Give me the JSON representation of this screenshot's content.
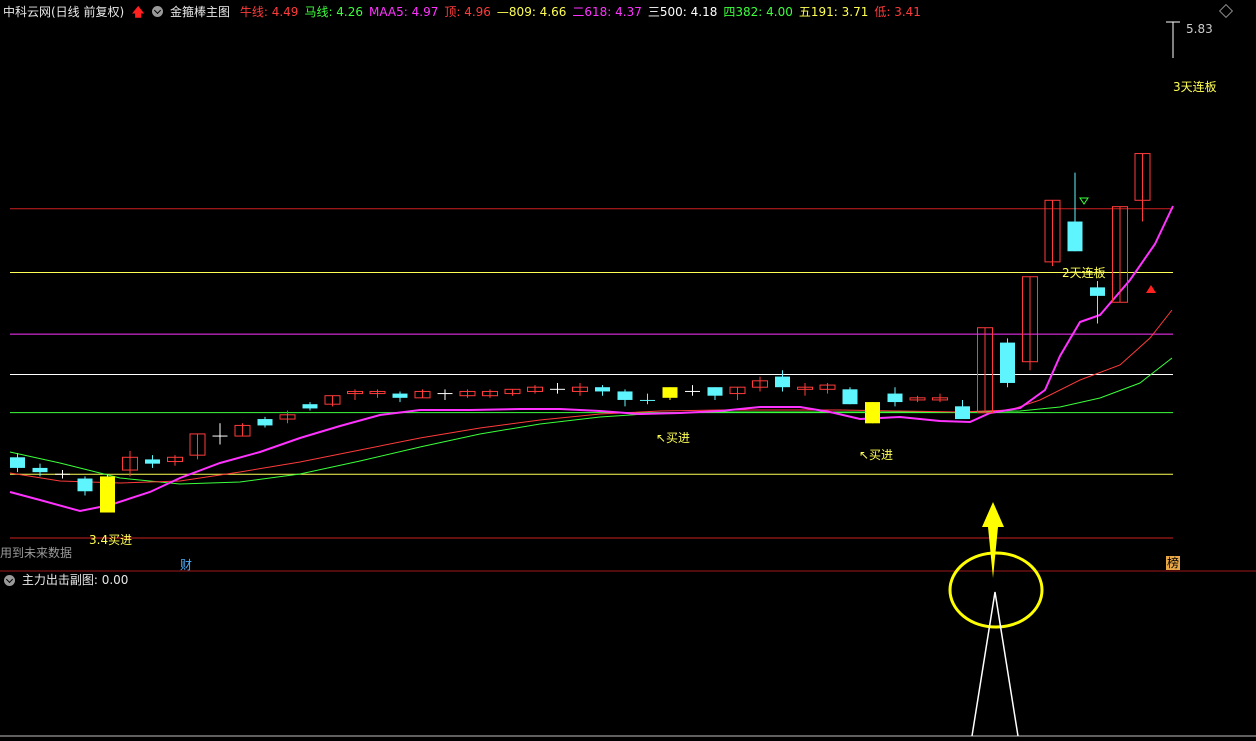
{
  "header": {
    "app_name": "中科云网(日线 前复权)",
    "indicator_name": "金箍棒主图",
    "items": [
      {
        "label": "牛线: ",
        "value": "4.49",
        "color": "#ff3b3b"
      },
      {
        "label": "马线: ",
        "value": "4.26",
        "color": "#3bff3b"
      },
      {
        "label": "MAA5: ",
        "value": "4.97",
        "color": "#ff33ff"
      },
      {
        "label": "顶: ",
        "value": "4.96",
        "color": "#ff3b3b"
      },
      {
        "label": "—809: ",
        "value": "4.66",
        "color": "#ffff55"
      },
      {
        "label": "二618: ",
        "value": "4.37",
        "color": "#ff33ff"
      },
      {
        "label": "三500: ",
        "value": "4.18",
        "color": "#ffffff"
      },
      {
        "label": "四382: ",
        "value": "4.00",
        "color": "#3bff3b"
      },
      {
        "label": "五191: ",
        "value": "3.71",
        "color": "#ffff55"
      },
      {
        "label": "低: ",
        "value": "3.41",
        "color": "#ff3b3b"
      }
    ]
  },
  "chart_annotations": {
    "high_price": "5.83",
    "limit_up_3": "3天连板",
    "limit_up_2": "2天连板",
    "buy_1": "3.4买进",
    "buy_2": "↖买进",
    "buy_3": "↖买进",
    "future_data_note": "用到未来数据",
    "finance_marker": "财",
    "rank_marker": "榜"
  },
  "sub_chart": {
    "title": "主力出击副图",
    "value_text": ": 0.00"
  },
  "colors": {
    "up": "#ff3b3b",
    "down": "#5ff5ff",
    "buy_candle": "#ffff00",
    "maa5": "#ff33ff",
    "niu": "#ff3b3b",
    "ma": "#3bff3b"
  },
  "chart_data": {
    "type": "candlestick",
    "levels": {
      "顶": 4.96,
      "—809": 4.66,
      "二618": 4.37,
      "三500": 4.18,
      "四382": 4.0,
      "五191": 3.71,
      "低": 3.41
    },
    "high_label": 5.83,
    "candles": [
      [
        3.79,
        3.74,
        3.81,
        3.72,
        "d"
      ],
      [
        3.74,
        3.72,
        3.76,
        3.7,
        "d"
      ],
      [
        3.71,
        3.71,
        3.73,
        3.69,
        "c"
      ],
      [
        3.69,
        3.63,
        3.7,
        3.61,
        "d"
      ],
      [
        3.53,
        3.7,
        3.71,
        3.53,
        "y"
      ],
      [
        3.73,
        3.79,
        3.82,
        3.7,
        "u"
      ],
      [
        3.78,
        3.76,
        3.8,
        3.74,
        "d"
      ],
      [
        3.77,
        3.79,
        3.8,
        3.75,
        "u"
      ],
      [
        3.8,
        3.9,
        3.9,
        3.78,
        "u"
      ],
      [
        3.89,
        3.89,
        3.95,
        3.85,
        "c"
      ],
      [
        3.89,
        3.94,
        3.95,
        3.89,
        "u"
      ],
      [
        3.94,
        3.97,
        3.98,
        3.93,
        "d"
      ],
      [
        3.97,
        3.99,
        4.01,
        3.95,
        "u"
      ],
      [
        4.04,
        4.02,
        4.05,
        4.01,
        "d"
      ],
      [
        4.04,
        4.08,
        4.08,
        4.03,
        "u"
      ],
      [
        4.09,
        4.1,
        4.11,
        4.06,
        "u"
      ],
      [
        4.09,
        4.1,
        4.11,
        4.07,
        "u"
      ],
      [
        4.09,
        4.07,
        4.1,
        4.05,
        "d"
      ],
      [
        4.07,
        4.1,
        4.11,
        4.07,
        "u"
      ],
      [
        4.09,
        4.09,
        4.11,
        4.06,
        "c"
      ],
      [
        4.08,
        4.1,
        4.11,
        4.07,
        "u"
      ],
      [
        4.08,
        4.1,
        4.11,
        4.07,
        "u"
      ],
      [
        4.09,
        4.11,
        4.11,
        4.08,
        "u"
      ],
      [
        4.1,
        4.12,
        4.13,
        4.09,
        "u"
      ],
      [
        4.11,
        4.11,
        4.14,
        4.09,
        "c"
      ],
      [
        4.1,
        4.12,
        4.14,
        4.08,
        "u"
      ],
      [
        4.12,
        4.1,
        4.13,
        4.08,
        "d"
      ],
      [
        4.1,
        4.06,
        4.11,
        4.03,
        "d"
      ],
      [
        4.06,
        4.06,
        4.09,
        4.04,
        "d"
      ],
      [
        4.07,
        4.12,
        4.12,
        4.06,
        "y"
      ],
      [
        4.1,
        4.1,
        4.13,
        4.08,
        "c"
      ],
      [
        4.12,
        4.08,
        4.12,
        4.06,
        "d"
      ],
      [
        4.09,
        4.12,
        4.12,
        4.06,
        "u"
      ],
      [
        4.12,
        4.15,
        4.17,
        4.1,
        "u"
      ],
      [
        4.17,
        4.12,
        4.2,
        4.1,
        "d"
      ],
      [
        4.12,
        4.11,
        4.14,
        4.08,
        "u"
      ],
      [
        4.13,
        4.11,
        4.14,
        4.09,
        "u"
      ],
      [
        4.11,
        4.04,
        4.12,
        4.04,
        "d"
      ],
      [
        3.95,
        4.05,
        4.05,
        3.95,
        "y"
      ],
      [
        4.09,
        4.05,
        4.12,
        4.03,
        "d"
      ],
      [
        4.06,
        4.07,
        4.08,
        4.05,
        "u"
      ],
      [
        4.06,
        4.07,
        4.09,
        4.05,
        "u"
      ],
      [
        4.03,
        3.97,
        4.06,
        3.97,
        "d"
      ],
      [
        4.0,
        4.4,
        4.4,
        4.0,
        "u"
      ],
      [
        4.33,
        4.14,
        4.35,
        4.12,
        "d"
      ],
      [
        4.24,
        4.64,
        4.64,
        4.2,
        "u"
      ],
      [
        4.71,
        5.0,
        5.0,
        4.69,
        "u"
      ],
      [
        4.9,
        4.76,
        5.13,
        4.76,
        "d"
      ],
      [
        4.59,
        4.55,
        4.62,
        4.42,
        "d"
      ],
      [
        4.52,
        4.97,
        4.97,
        4.52,
        "u"
      ],
      [
        5.0,
        5.22,
        5.22,
        4.9,
        "u"
      ]
    ]
  }
}
